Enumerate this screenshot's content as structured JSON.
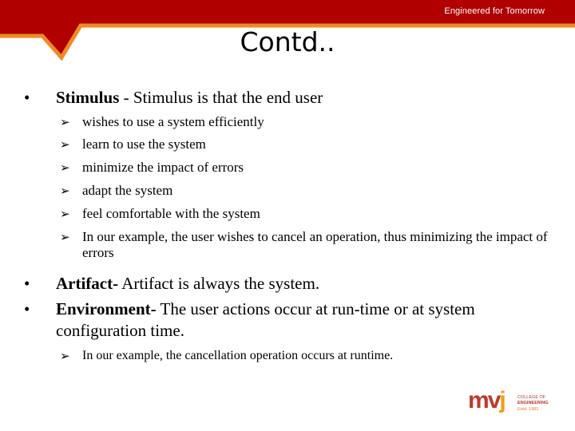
{
  "header": {
    "tagline": "Engineered for Tomorrow",
    "colors": {
      "banner": "#b00000",
      "accent": "#f08a24"
    }
  },
  "slide": {
    "title": "Contd..",
    "bullets": [
      {
        "term": "Stimulus",
        "text": " - Stimulus is that the end user",
        "sub": [
          "wishes to use a system efficiently",
          "learn to use the system",
          "minimize the impact of errors",
          "adapt the system",
          "feel comfortable with the system",
          "In our example, the user wishes to cancel an operation, thus minimizing the impact of errors"
        ]
      },
      {
        "term": "Artifact-",
        "text": " Artifact is always the system.",
        "sub": []
      },
      {
        "term": "Environment-",
        "text": " The user actions occur at run-time or at system configuration time.",
        "sub": [
          "In our example, the cancellation operation occurs at runtime."
        ]
      }
    ],
    "bullet_glyph": "•",
    "sub_bullet_glyph": "➢"
  },
  "logo": {
    "mark_m": "m",
    "mark_v": "v",
    "mark_j": "j",
    "line1": "COLLEGE OF",
    "line2": "ENGINEERING",
    "line3": "Estd. 1982"
  }
}
